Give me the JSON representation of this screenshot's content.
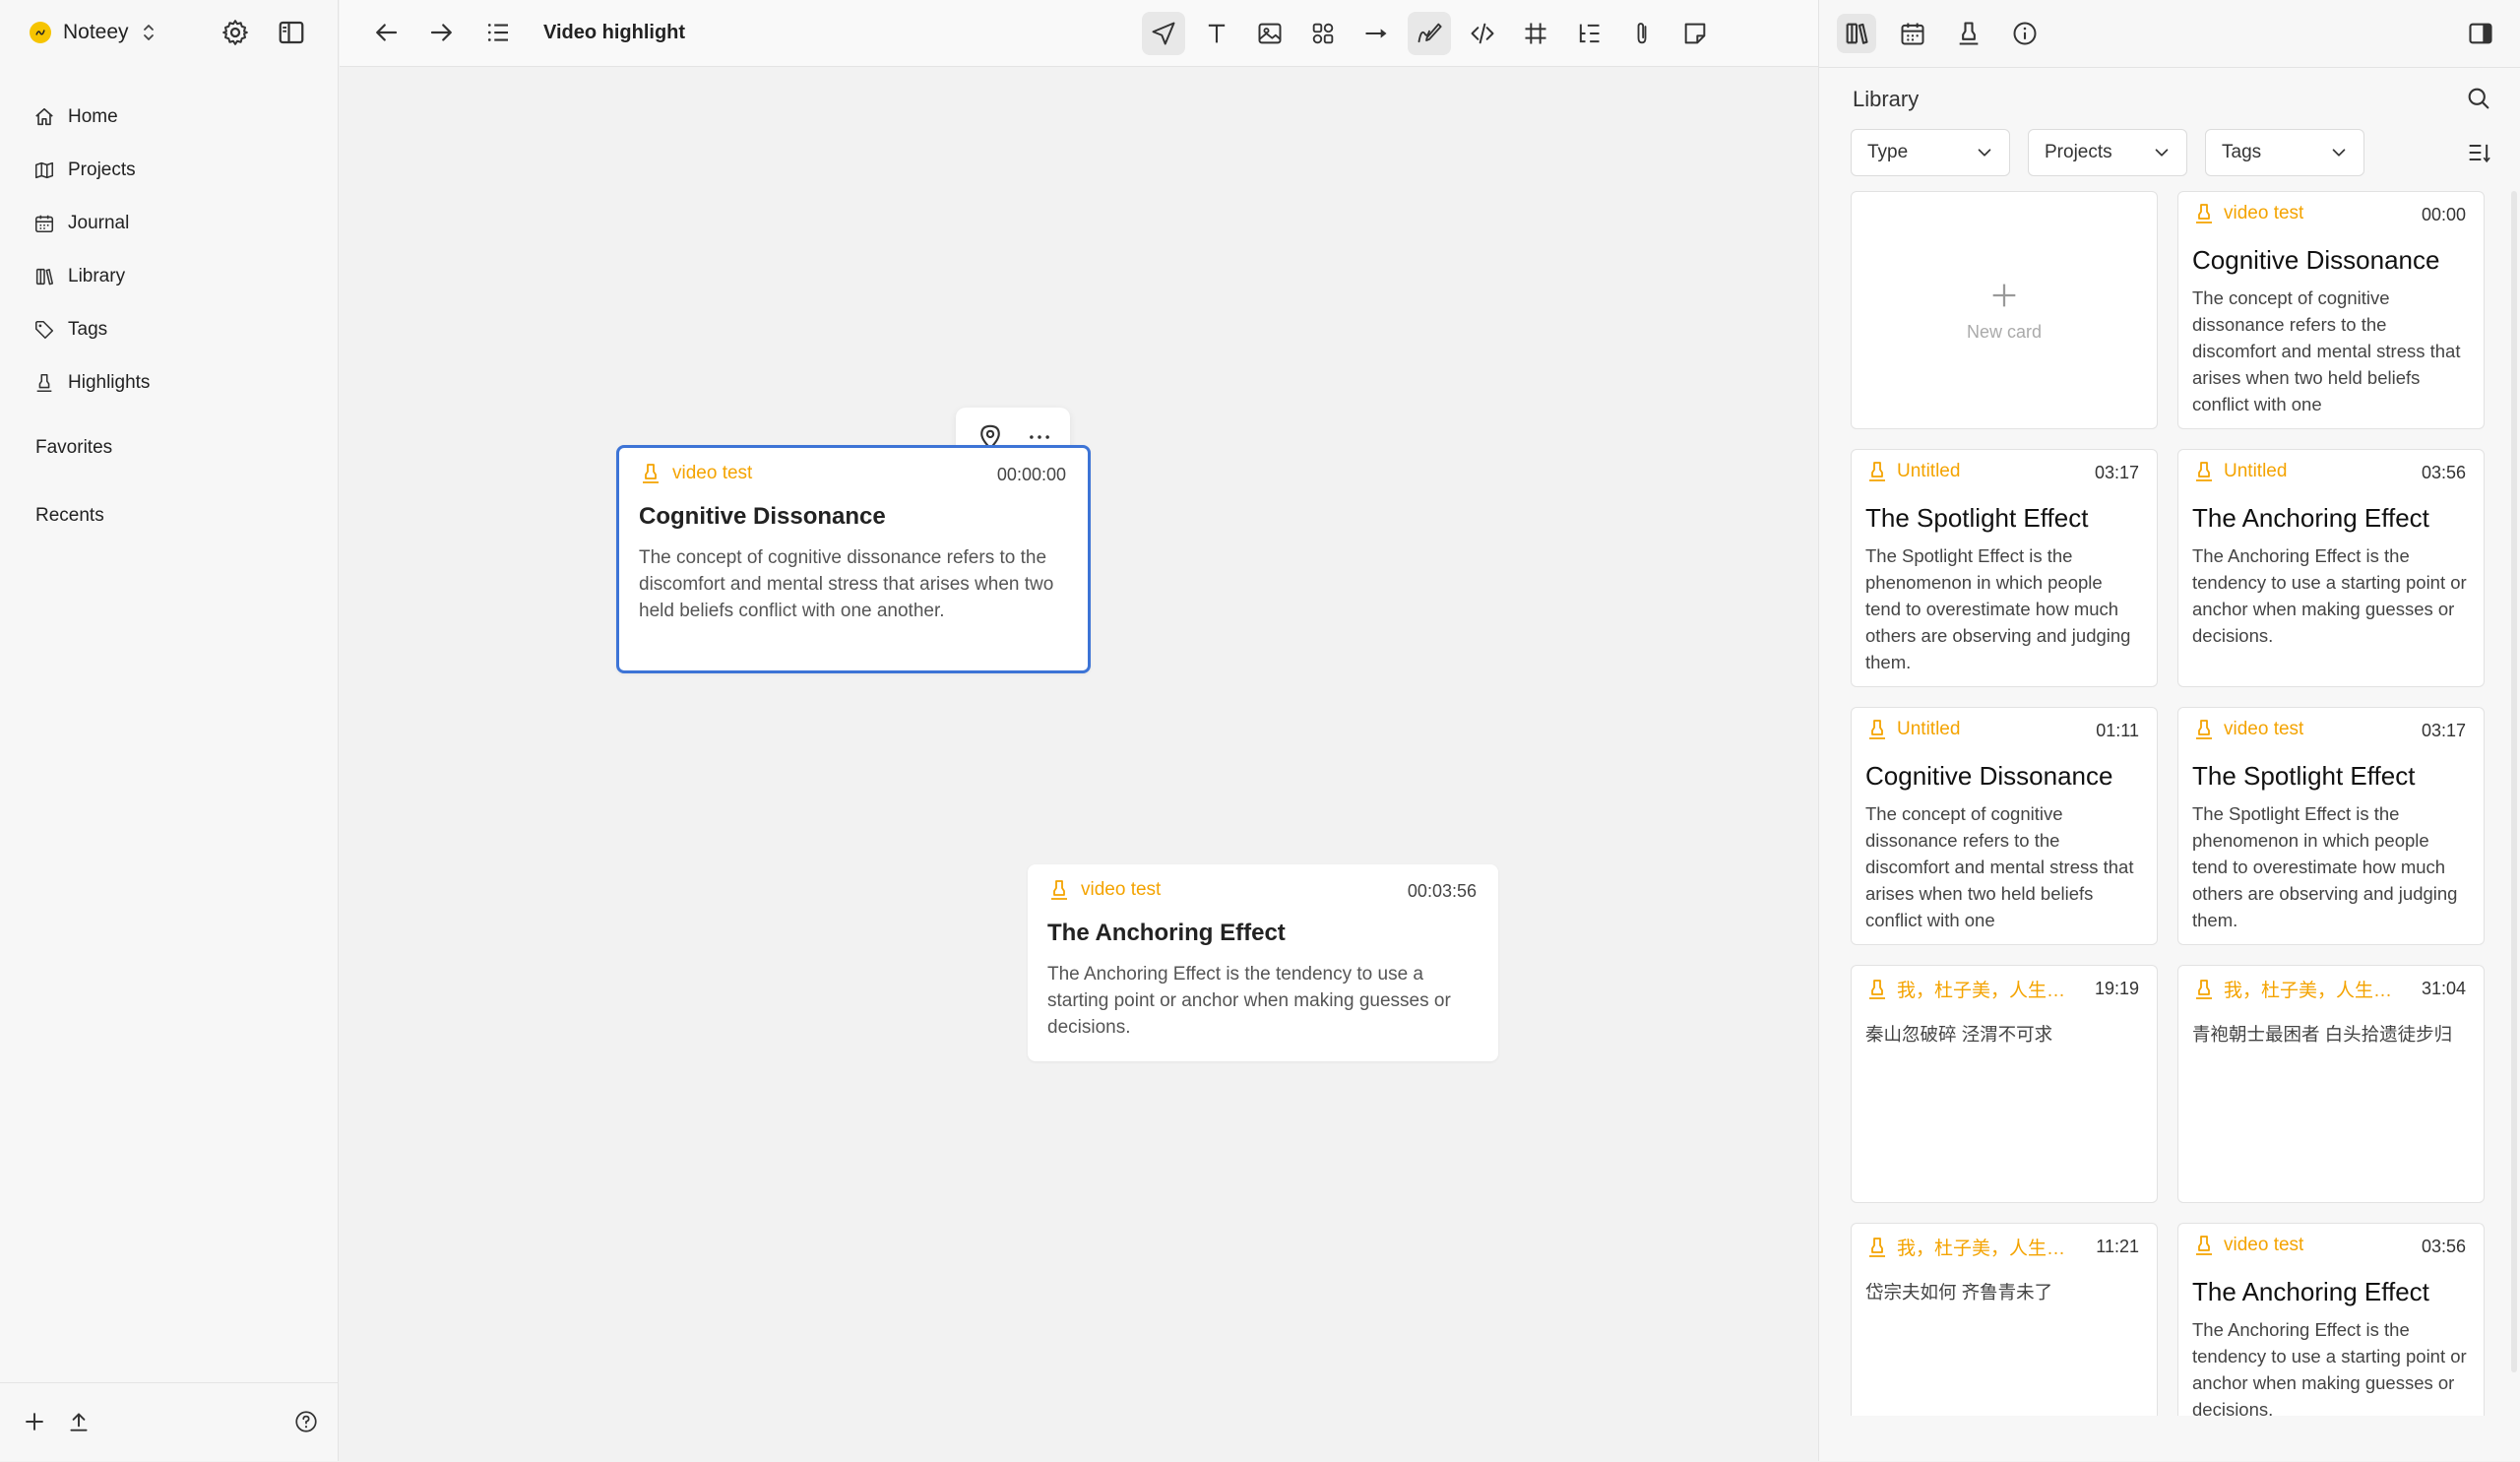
{
  "app": {
    "name": "Noteey"
  },
  "sidebar": {
    "nav": [
      {
        "label": "Home",
        "icon": "home-icon"
      },
      {
        "label": "Projects",
        "icon": "map-icon"
      },
      {
        "label": "Journal",
        "icon": "calendar-icon"
      },
      {
        "label": "Library",
        "icon": "library-icon"
      },
      {
        "label": "Tags",
        "icon": "tag-icon"
      },
      {
        "label": "Highlights",
        "icon": "highlighter-icon"
      }
    ],
    "favorites_label": "Favorites",
    "recents_label": "Recents"
  },
  "toolbar": {
    "title": "Video highlight",
    "tools": [
      "select-tool-icon",
      "text-tool-icon",
      "image-tool-icon",
      "shapes-tool-icon",
      "arrow-tool-icon",
      "pen-tool-icon",
      "code-tool-icon",
      "frame-tool-icon",
      "list-tool-icon",
      "attachment-tool-icon",
      "sticky-note-tool-icon"
    ]
  },
  "canvas": {
    "cards": [
      {
        "source": "video test",
        "time": "00:00:00",
        "title": "Cognitive Dissonance",
        "body": "The concept of cognitive dissonance refers to the discomfort and mental stress that arises when two held beliefs conflict with one another.",
        "selected": true
      },
      {
        "source": "video test",
        "time": "00:03:56",
        "title": "The Anchoring Effect",
        "body": "The Anchoring Effect is the tendency to use a starting point or anchor when making guesses or decisions.",
        "selected": false
      }
    ]
  },
  "library": {
    "title": "Library",
    "filters": [
      "Type",
      "Projects",
      "Tags"
    ],
    "new_card_label": "New card",
    "cards": [
      {
        "source": "video test",
        "time": "00:00",
        "title": "Cognitive Dissonance",
        "body": "The concept of cognitive dissonance refers to the discomfort and mental stress that arises when two held beliefs conflict with one"
      },
      {
        "source": "Untitled",
        "time": "03:17",
        "title": "The Spotlight Effect",
        "body": "The Spotlight Effect is the phenomenon in which people tend to overestimate how much others are observing and judging them."
      },
      {
        "source": "Untitled",
        "time": "03:56",
        "title": "The Anchoring Effect",
        "body": "The Anchoring Effect is the tendency to use a starting point or anchor when making guesses or decisions."
      },
      {
        "source": "Untitled",
        "time": "01:11",
        "title": "Cognitive Dissonance",
        "body": "The concept of cognitive dissonance refers to the discomfort and mental stress that arises when two held beliefs conflict with one"
      },
      {
        "source": "video test",
        "time": "03:17",
        "title": "The Spotlight Effect",
        "body": "The Spotlight Effect is the phenomenon in which people tend to overestimate how much others are observing and judging them."
      },
      {
        "source": "我，杜子美，人生六十...",
        "time": "19:19",
        "title": "",
        "body": "秦山忽破碎 泾渭不可求"
      },
      {
        "source": "我，杜子美，人生六十...",
        "time": "31:04",
        "title": "",
        "body": "青袍朝士最困者 白头拾遗徒步归"
      },
      {
        "source": "我，杜子美，人生六十...",
        "time": "11:21",
        "title": "",
        "body": "岱宗夫如何 齐鲁青未了"
      },
      {
        "source": "video test",
        "time": "03:56",
        "title": "The Anchoring Effect",
        "body": "The Anchoring Effect is the tendency to use a starting point or anchor when making guesses or decisions."
      }
    ]
  },
  "colors": {
    "accent": "#f4a300",
    "selection": "#3d74d6",
    "brand": "#f6c400"
  }
}
